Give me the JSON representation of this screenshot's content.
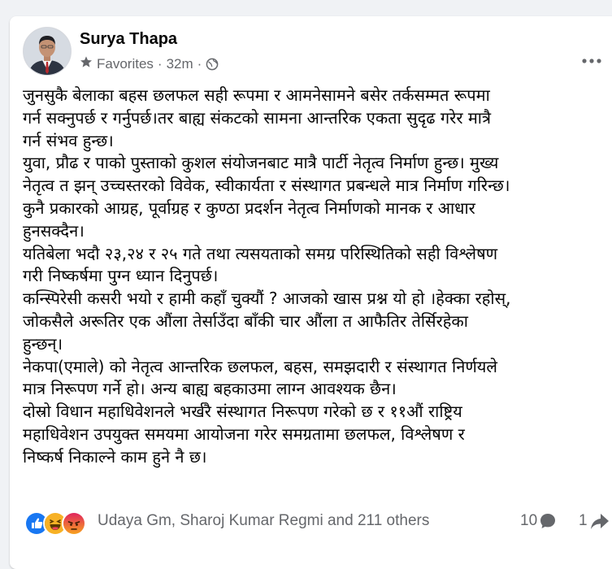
{
  "post": {
    "author": "Surya Thapa",
    "audience": "Favorites",
    "separator": "·",
    "time": "32m",
    "paragraphs": [
      "जुनसुकै बेलाका बहस छलफल सही रूपमा र आमनेसामने बसेर तर्कसम्मत रूपमा",
      "गर्न सक्नुपर्छ र गर्नुपर्छ।तर बाह्य संकटको सामना आन्तरिक एकता सुदृढ गरेर मात्रै",
      "गर्न संभव हुन्छ।",
      "युवा, प्रौढ र पाको पुस्ताको कुशल संयोजनबाट मात्रै पार्टी नेतृत्व निर्माण हुन्छ। मुख्य",
      "नेतृत्व त झन् उच्चस्तरको विवेक, स्वीकार्यता र संस्थागत प्रबन्धले मात्र निर्माण गरिन्छ।",
      "कुनै प्रकारको आग्रह, पूर्वाग्रह र कुण्ठा प्रदर्शन नेतृत्व निर्माणको मानक र आधार",
      "हुनसक्दैन।",
      "यतिबेला भदौ २३,२४ र २५ गते तथा त्यसयताको समग्र परिस्थितिको सही विश्लेषण",
      "गरी निष्कर्षमा पुग्न ध्यान दिनुपर्छ।",
      "कन्स्पिरेसी कसरी भयो र हामी कहाँ चुक्यौं ? आजको खास प्रश्न यो हो ।हेक्का रहोस्,",
      "जोकसैले अरूतिर एक औंला तेर्साउँदा बाँकी चार औंला त आफैतिर तेर्सिरहेका",
      "हुन्छन्।",
      "नेकपा(एमाले) को नेतृत्व आन्तरिक छलफल, बहस, समझदारी र संस्थागत निर्णयले",
      "मात्र निरूपण गर्ने हो। अन्य बाह्य बहकाउमा लाग्न आवश्यक छैन।",
      "दोस्रो विधान महाधिवेशनले भर्खरै संस्थागत निरूपण गरेको छ र ११औं राष्ट्रिय",
      "महाधिवेशन उपयुक्त समयमा आयोजना गरेर समग्रतामा छलफल, विश्लेषण र",
      "निष्कर्ष निकाल्ने काम हुने नै छ।"
    ]
  },
  "footer": {
    "reactors": "Udaya Gm, Sharoj Kumar Regmi and 211 others",
    "comments_count": "10",
    "shares_count": "1"
  },
  "icons": {
    "audience": "star-icon",
    "privacy": "globe-icon",
    "more": "more-options-icon",
    "reactions": [
      "like-icon",
      "haha-icon",
      "angry-icon"
    ],
    "comments": "comment-bubble-icon",
    "shares": "share-icon"
  },
  "colors": {
    "like": "#1877f2",
    "haha": "#f7b125",
    "angry": "#e9710f",
    "secondary_text": "#65676b",
    "primary_text": "#050505",
    "page_background": "#f0f2f5"
  }
}
